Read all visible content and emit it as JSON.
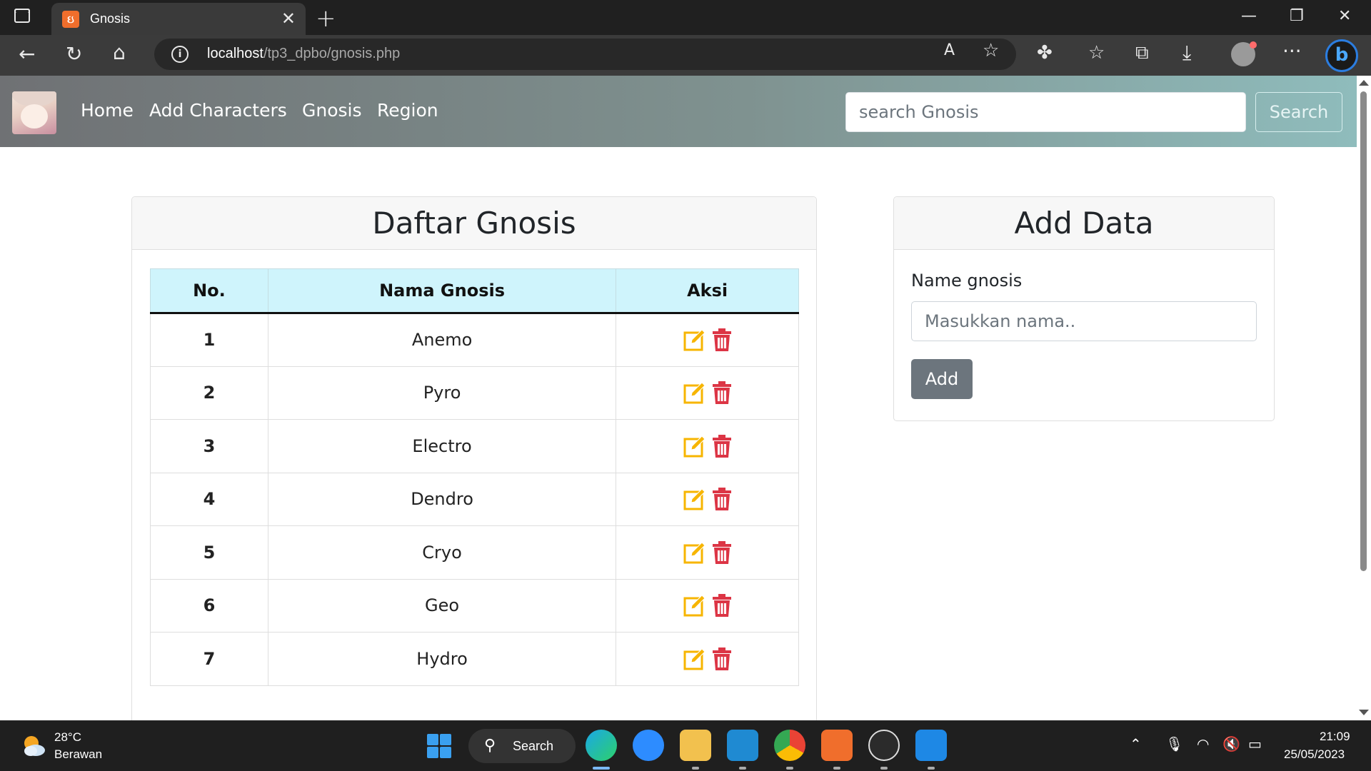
{
  "browser": {
    "tab_title": "Gnosis",
    "address": {
      "host": "localhost",
      "path": "/tp3_dpbo/gnosis.php"
    }
  },
  "navbar": {
    "links": [
      "Home",
      "Add Characters",
      "Gnosis",
      "Region"
    ],
    "search_placeholder": "search Gnosis",
    "search_button": "Search"
  },
  "list_card": {
    "title": "Daftar Gnosis",
    "columns": [
      "No.",
      "Nama Gnosis",
      "Aksi"
    ],
    "rows": [
      {
        "no": "1",
        "name": "Anemo"
      },
      {
        "no": "2",
        "name": "Pyro"
      },
      {
        "no": "3",
        "name": "Electro"
      },
      {
        "no": "4",
        "name": "Dendro"
      },
      {
        "no": "5",
        "name": "Cryo"
      },
      {
        "no": "6",
        "name": "Geo"
      },
      {
        "no": "7",
        "name": "Hydro"
      }
    ],
    "action_icons": [
      "edit-icon",
      "delete-icon"
    ]
  },
  "add_card": {
    "title": "Add Data",
    "label": "Name gnosis",
    "placeholder": "Masukkan nama..",
    "button": "Add"
  },
  "taskbar": {
    "weather_temp": "28°C",
    "weather_condition": "Berawan",
    "search_label": "Search",
    "time": "21:09",
    "date": "25/05/2023"
  },
  "colors": {
    "edit": "#f7b500",
    "delete": "#dc3545",
    "table_header": "#cff4fc",
    "add_button": "#6c757d"
  }
}
